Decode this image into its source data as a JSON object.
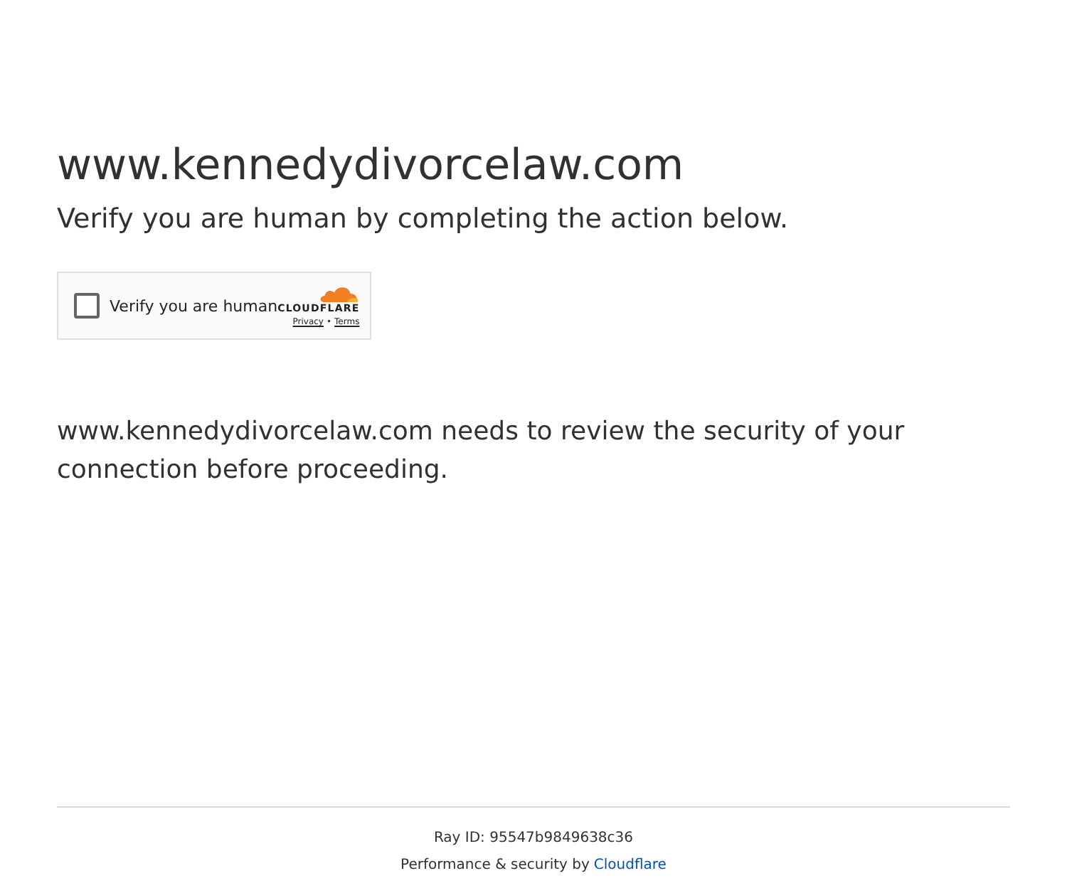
{
  "heading": "www.kennedydivorcelaw.com",
  "subtitle": "Verify you are human by completing the action below.",
  "widget": {
    "checked": false,
    "label": "Verify you are human",
    "logo_text": "CLOUDFLARE",
    "privacy_link": "Privacy",
    "separator": "•",
    "terms_link": "Terms"
  },
  "message": "www.kennedydivorcelaw.com needs to review the security of your connection before proceeding.",
  "footer": {
    "ray_id": "Ray ID: 95547b9849638c36",
    "performance_text": "Performance & security by",
    "cloudflare_link": "Cloudflare"
  }
}
